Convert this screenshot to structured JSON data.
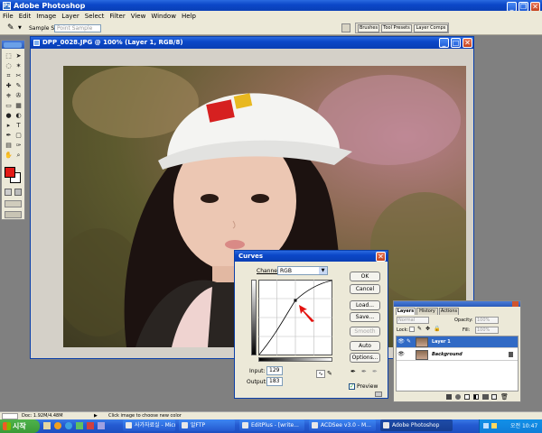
{
  "app": {
    "title": "Adobe Photoshop",
    "menu": [
      "File",
      "Edit",
      "Image",
      "Layer",
      "Select",
      "Filter",
      "View",
      "Window",
      "Help"
    ]
  },
  "options_bar": {
    "sample_size_label": "Sample Size:",
    "sample_size_value": "Point Sample",
    "tabs": [
      "Brushes",
      "Tool Presets",
      "Layer Comps"
    ]
  },
  "document": {
    "title": "DPP_0028.JPG @ 100% (Layer 1, RGB/8)"
  },
  "curves": {
    "title": "Curves",
    "channel_label": "Channel:",
    "channel_value": "RGB",
    "buttons": [
      "OK",
      "Cancel",
      "Load...",
      "Save...",
      "Smooth",
      "Auto",
      "Options..."
    ],
    "input_label": "Input:",
    "input_value": "129",
    "output_label": "Output:",
    "output_value": "183",
    "preview_label": "Preview",
    "preview_checked": true
  },
  "layers_panel": {
    "tabs": [
      "Layers",
      "History",
      "Actions"
    ],
    "blend_mode": "Normal",
    "opacity_label": "Opacity:",
    "opacity_value": "100%",
    "lock_label": "Lock:",
    "fill_label": "Fill:",
    "fill_value": "100%",
    "layers": [
      {
        "name": "Layer 1",
        "selected": true
      },
      {
        "name": "Background",
        "selected": false
      }
    ]
  },
  "status_bar": {
    "doc_info": "Doc: 1.92M/4.48M",
    "hint": "Click image to choose new color"
  },
  "taskbar": {
    "start_label": "시작",
    "items": [
      "사가자료실 - Micr...",
      "알FTP",
      "EditPlus - [write...",
      "ACDSee v3.0 - M...",
      "Adobe Photoshop"
    ],
    "clock": "오전 10:47"
  },
  "colors": {
    "foreground": "#e31b17",
    "background": "#ffffff",
    "xp_blue": "#0b47c8",
    "selected_layer": "#316ac5"
  }
}
